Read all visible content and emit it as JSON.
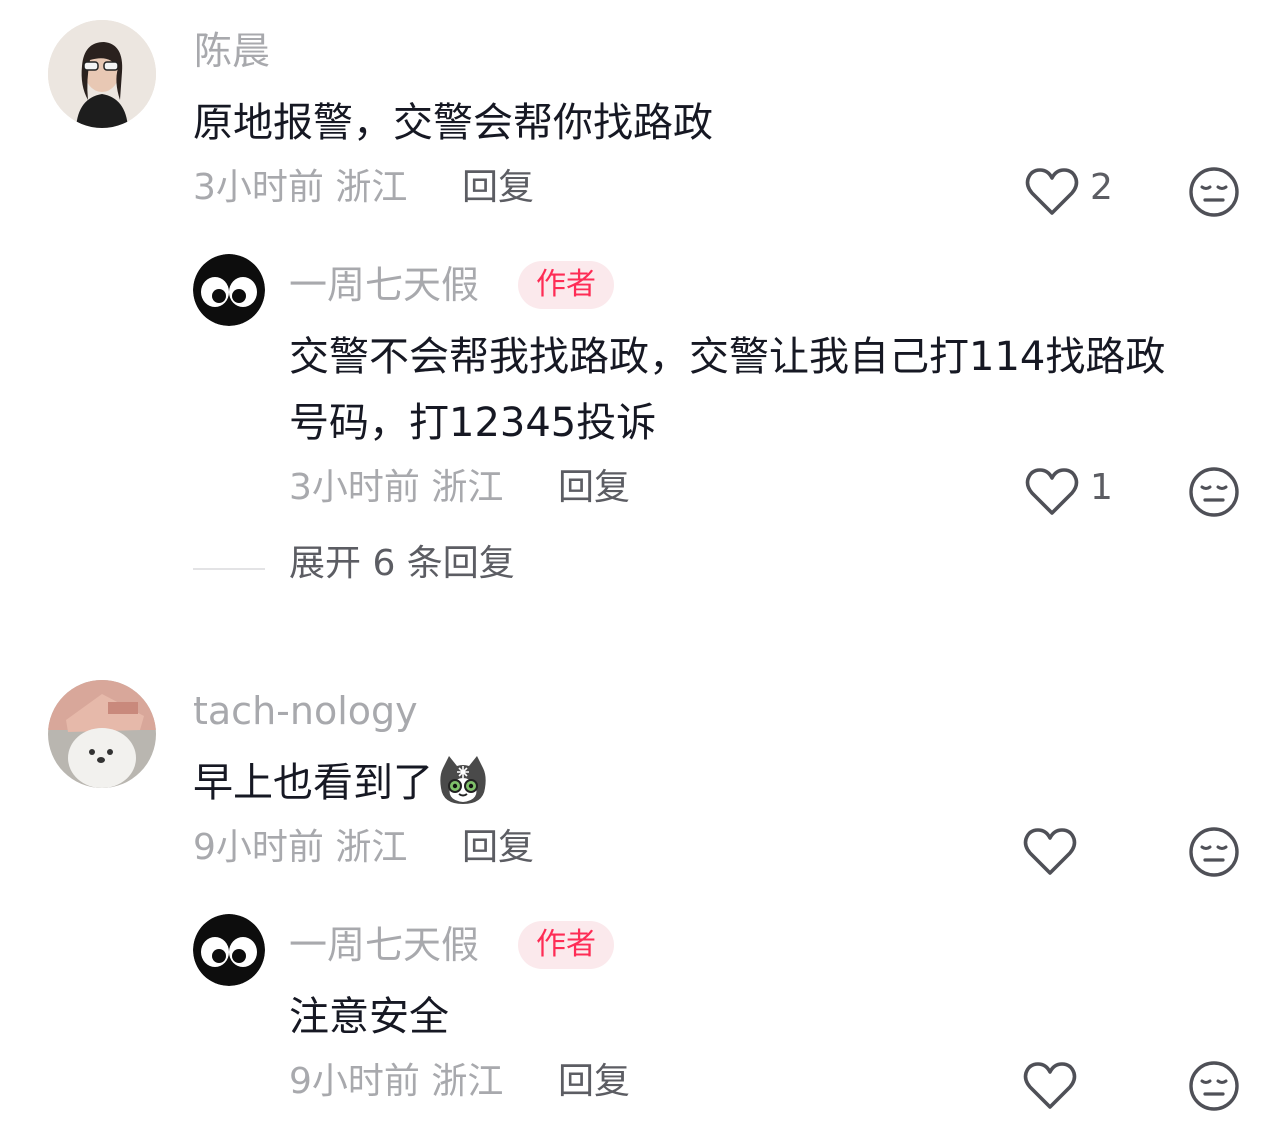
{
  "comments": [
    {
      "username": "陈晨",
      "text": "原地报警，交警会帮你找路政",
      "time": "3小时前",
      "location": "浙江",
      "reply_label": "回复",
      "likes": "2",
      "reply": {
        "username": "一周七天假",
        "badge": "作者",
        "text_line1": "交警不会帮我找路政，交警让我自己打114找路政",
        "text_line2": "号码，打12345投诉",
        "time": "3小时前",
        "location": "浙江",
        "reply_label": "回复",
        "likes": "1"
      },
      "expand_label": "展开 6 条回复"
    },
    {
      "username": "tach-nology",
      "text": "早上也看到了",
      "time": "9小时前",
      "location": "浙江",
      "reply_label": "回复",
      "likes": "",
      "reply": {
        "username": "一周七天假",
        "badge": "作者",
        "text": "注意安全",
        "time": "9小时前",
        "location": "浙江",
        "reply_label": "回复",
        "likes": ""
      }
    }
  ],
  "icons": {
    "like": "heart-outline-icon",
    "dislike": "meh-face-icon",
    "emoji": "cat-emoji-icon"
  },
  "colors": {
    "text": "#161823",
    "muted": "#a8a9ad",
    "secondary": "#5c5d63",
    "author_accent": "#fe2c55",
    "author_bg": "#fbe9ec"
  }
}
